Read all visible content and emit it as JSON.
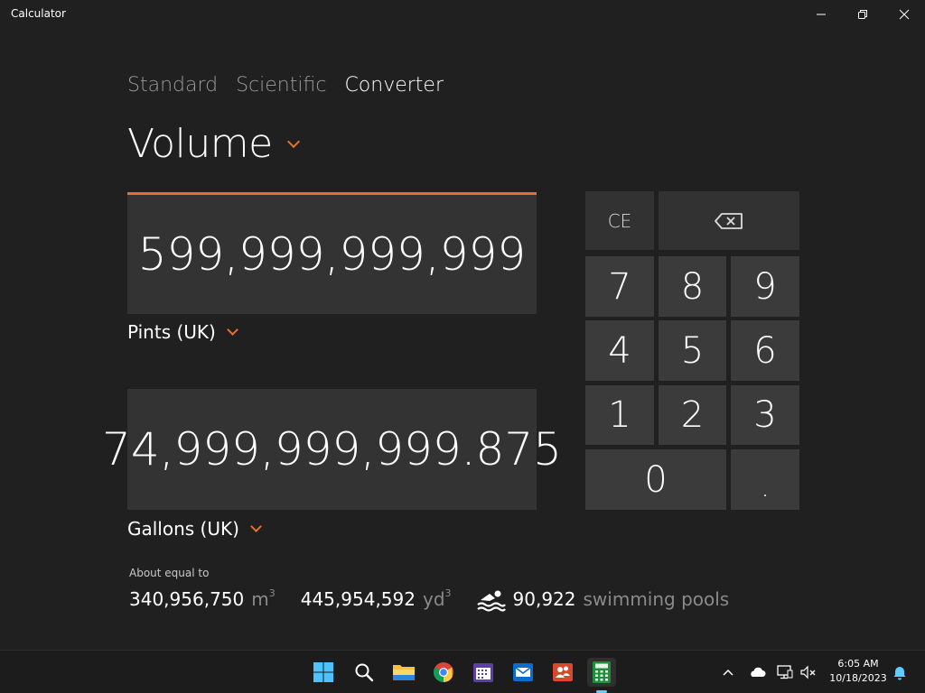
{
  "window": {
    "title": "Calculator",
    "controls": {
      "minimize": "—",
      "maximize": "❐",
      "close": "✕"
    }
  },
  "tabs": [
    {
      "label": "Standard",
      "active": false
    },
    {
      "label": "Scientific",
      "active": false
    },
    {
      "label": "Converter",
      "active": true
    }
  ],
  "category": {
    "label": "Volume"
  },
  "from": {
    "value": "599,999,999,999",
    "unit": "Pints (UK)"
  },
  "to": {
    "value": "74,999,999,999.875",
    "unit": "Gallons (UK)"
  },
  "about": {
    "label": "About equal to",
    "items": [
      {
        "value": "340,956,750",
        "unit": "m",
        "exp": "3"
      },
      {
        "value": "445,954,592",
        "unit": "yd",
        "exp": "3"
      },
      {
        "value": "90,922",
        "unit": "swimming pools",
        "icon": "swimming-pool-icon"
      }
    ]
  },
  "keypad": {
    "ce": "CE",
    "backspace_icon": "backspace-icon",
    "digits": [
      "7",
      "8",
      "9",
      "4",
      "5",
      "6",
      "1",
      "2",
      "3",
      "0",
      "."
    ]
  },
  "taskbar": {
    "apps": [
      "windows-start-icon",
      "search-icon",
      "file-explorer-icon",
      "chrome-icon",
      "calendar-icon",
      "mail-icon",
      "people-icon",
      "calculator-icon"
    ],
    "time": "6:05 AM",
    "date": "10/18/2023"
  },
  "colors": {
    "accent": "#e4712c",
    "background": "#202020",
    "key": "#3b3b3b",
    "display": "#333333"
  }
}
